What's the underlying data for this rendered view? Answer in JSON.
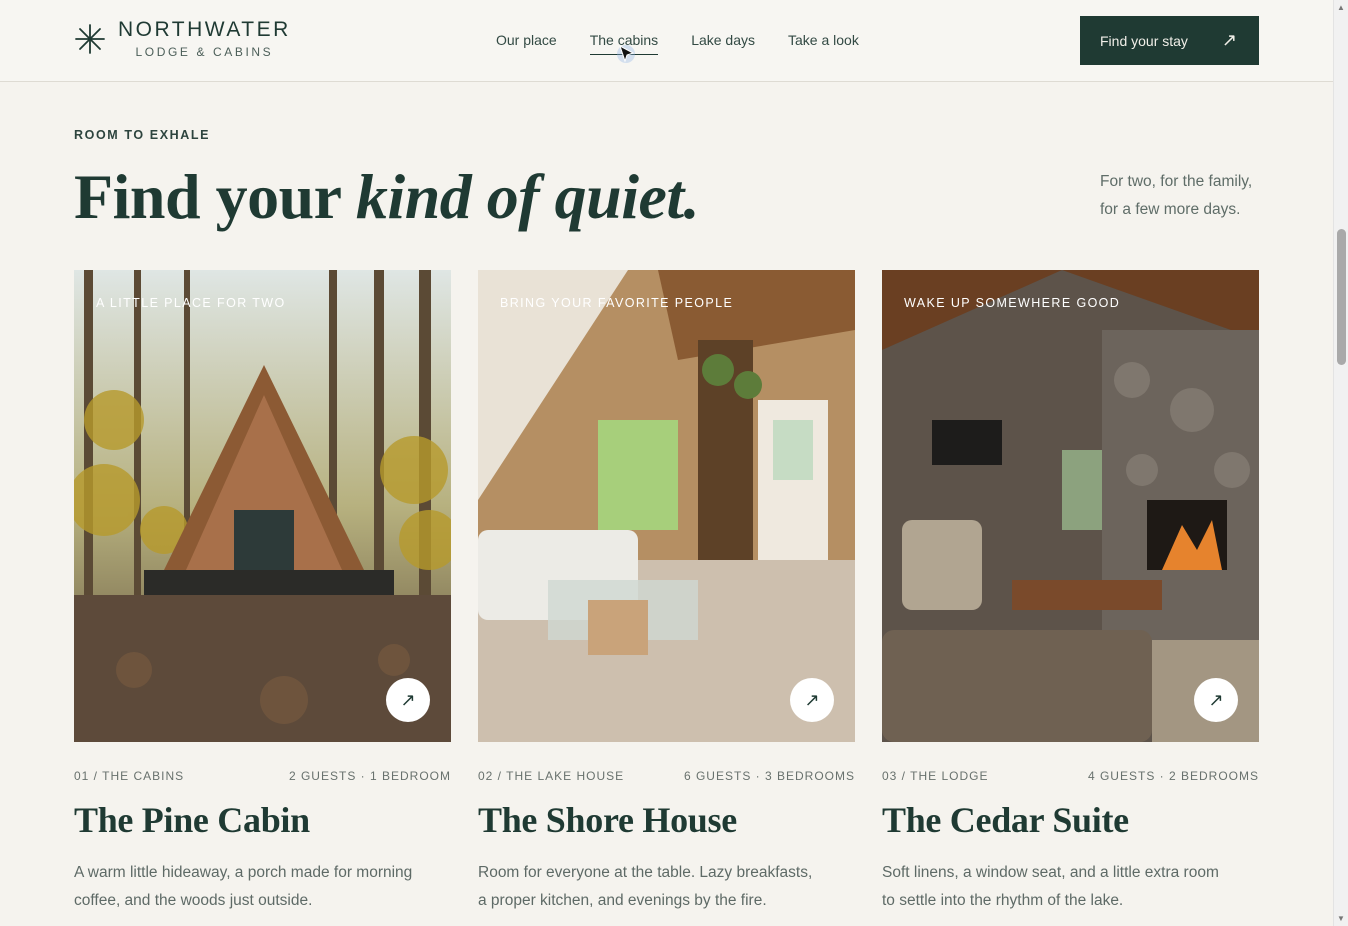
{
  "brand": {
    "name": "NORTHWATER",
    "subtitle": "LODGE & CABINS"
  },
  "nav": [
    {
      "label": "Our place"
    },
    {
      "label": "The cabins",
      "active": true
    },
    {
      "label": "Lake days"
    },
    {
      "label": "Take a look"
    }
  ],
  "cta": {
    "label": "Find your stay",
    "icon": "arrow-up-right-icon"
  },
  "section": {
    "eyebrow": "ROOM TO EXHALE",
    "headline_plain": "Find your ",
    "headline_italic": "kind of quiet.",
    "tagline": "For two, for the family, for a few more days."
  },
  "cards": [
    {
      "label": "A LITTLE PLACE FOR TWO",
      "meta_left": "01 / THE CABINS",
      "meta_right": "2 GUESTS · 1 BEDROOM",
      "title": "The Pine Cabin",
      "description": "A warm little hideaway, a porch made for morning coffee, and the woods just outside."
    },
    {
      "label": "BRING YOUR FAVORITE PEOPLE",
      "meta_left": "02 / THE LAKE HOUSE",
      "meta_right": "6 GUESTS · 3 BEDROOMS",
      "title": "The Shore House",
      "description": "Room for everyone at the table. Lazy breakfasts, a proper kitchen, and evenings by the fire."
    },
    {
      "label": "WAKE UP SOMEWHERE GOOD",
      "meta_left": "03 / THE LODGE",
      "meta_right": "4 GUESTS · 2 BEDROOMS",
      "title": "The Cedar Suite",
      "description": "Soft linens, a window seat, and a little extra room to settle into the rhythm of the lake."
    }
  ],
  "colors": {
    "primary": "#1f3a33",
    "background": "#f5f3ee",
    "muted": "#5e6a66"
  }
}
